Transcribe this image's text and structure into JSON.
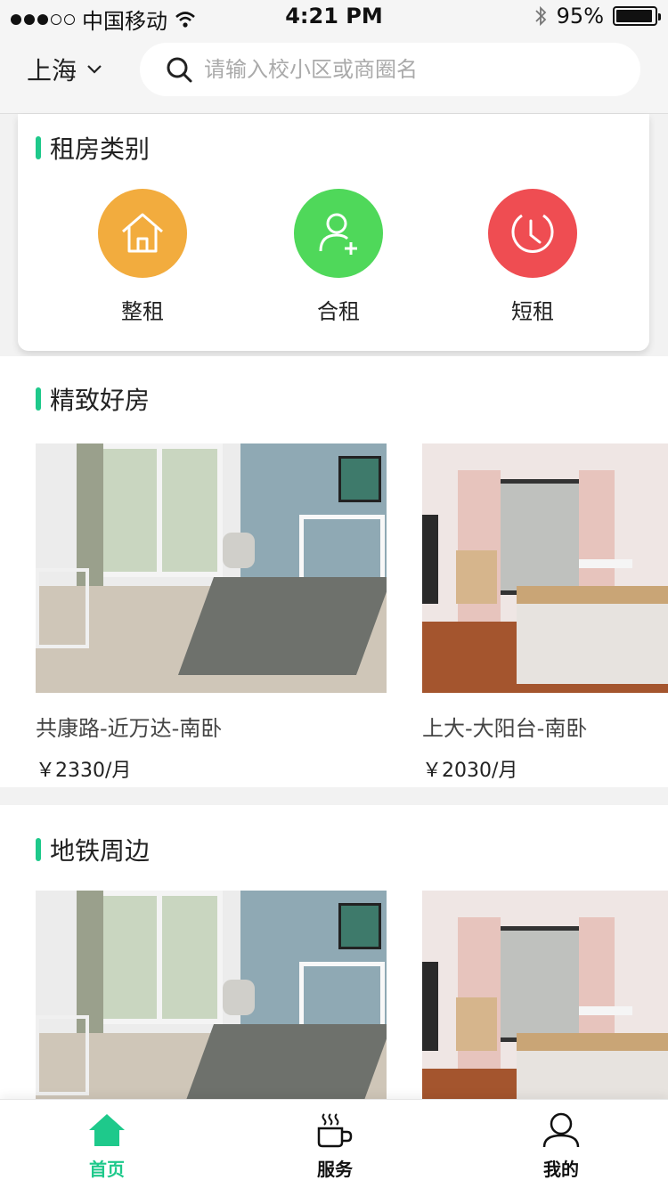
{
  "status_bar": {
    "carrier": "中国移动",
    "time": "4:21 PM",
    "battery": "95%",
    "battery_level": 0.95
  },
  "header": {
    "city": "上海",
    "search_placeholder": "请输入校小区或商圈名"
  },
  "rent_types": {
    "title": "租房类别",
    "items": [
      {
        "label": "整租",
        "icon": "house-icon",
        "color": "#f2ac3e"
      },
      {
        "label": "合租",
        "icon": "add-person-icon",
        "color": "#4fd85a"
      },
      {
        "label": "短租",
        "icon": "clock-icon",
        "color": "#ef4d52"
      }
    ]
  },
  "featured": {
    "title": "精致好房",
    "listings": [
      {
        "name": "共康路-近万达-南卧",
        "price": "￥2330/月"
      },
      {
        "name": "上大-大阳台-南卧",
        "price": "￥2030/月"
      }
    ]
  },
  "subway": {
    "title": "地铁周边"
  },
  "tabs": [
    {
      "label": "首页",
      "icon": "home-icon",
      "active": true
    },
    {
      "label": "服务",
      "icon": "coffee-cup-icon",
      "active": false
    },
    {
      "label": "我的",
      "icon": "user-icon",
      "active": false
    }
  ],
  "colors": {
    "accent": "#1ec98b",
    "background": "#f2f2f2"
  }
}
